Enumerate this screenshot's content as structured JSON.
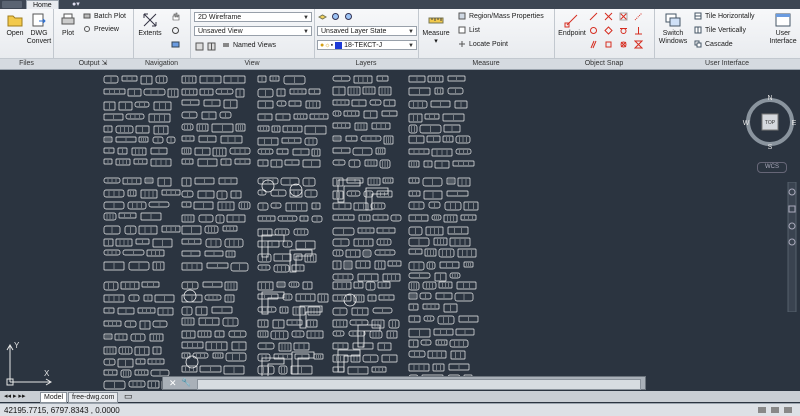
{
  "titlebar": {
    "tabs": [
      "Home"
    ]
  },
  "ribbon": {
    "panels": {
      "files": {
        "title": "Files",
        "open": "Open",
        "dwg_convert": "DWG\nConvert"
      },
      "output": {
        "title": "Output",
        "plot": "Plot",
        "batch_plot": "Batch Plot",
        "preview": "Preview"
      },
      "navigation": {
        "title": "Navigation",
        "extents": "Extents"
      },
      "view": {
        "title": "View",
        "visual_style": "2D Wireframe",
        "named_view": "Unsaved View",
        "named_views": "Named Views"
      },
      "layers": {
        "title": "Layers",
        "layer_state": "Unsaved Layer State",
        "current_layer": "18-ТЕКСТ-J"
      },
      "measure": {
        "title": "Measure",
        "measure": "Measure",
        "region_mass": "Region/Mass Properties",
        "list": "List",
        "locate_point": "Locate Point"
      },
      "object_snap": {
        "title": "Object Snap",
        "endpoint": "Endpoint"
      },
      "user_interface": {
        "title": "User Interface",
        "switch_windows": "Switch\nWindows",
        "tile_h": "Tile Horizontally",
        "tile_v": "Tile Vertically",
        "cascade": "Cascade",
        "user_iface": "User\nInterface"
      }
    }
  },
  "viewcube": {
    "n": "N",
    "s": "S",
    "e": "E",
    "w": "W",
    "top": "TOP",
    "wcs": "WCS"
  },
  "ucs": {
    "x": "X",
    "y": "Y"
  },
  "command": {
    "placeholder": ""
  },
  "layout_tabs": [
    "Model",
    "free-dwg.com"
  ],
  "status": {
    "coordinates": "42195.7715, 6797.8343 , 0.0000"
  }
}
